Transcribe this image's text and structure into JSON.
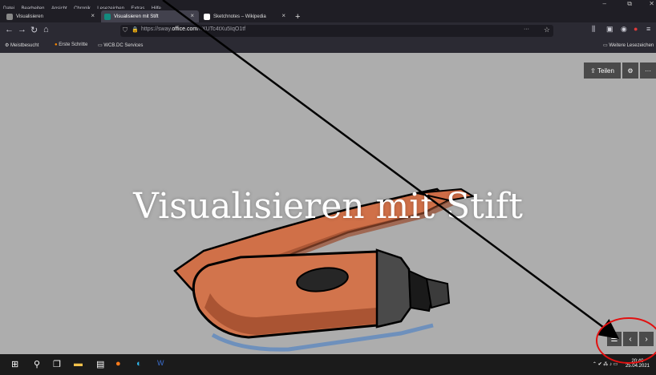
{
  "menu": [
    "Datei",
    "Bearbeiten",
    "Ansicht",
    "Chronik",
    "Lesezeichen",
    "Extras",
    "Hilfe"
  ],
  "tabs": [
    {
      "label": "Visualisieren"
    },
    {
      "label": "Visualisieren mit Stift"
    },
    {
      "label": "Sketchnotes – Wikipedia"
    }
  ],
  "address": {
    "prefix": "https://sway.",
    "domain": "office.com",
    "suffix": "/hXUTc4tXu5IqO1tf"
  },
  "bookmarks": [
    "Meistbesucht",
    "Erste Schritte",
    "WCB.DC Services"
  ],
  "bookmarks_right": "Weitere Lesezeichen",
  "sway": {
    "share_label": "Teilen",
    "title": "Visualisieren mit Stift"
  },
  "taskbar": {
    "time": "20:40",
    "date": "25.04.2021"
  }
}
